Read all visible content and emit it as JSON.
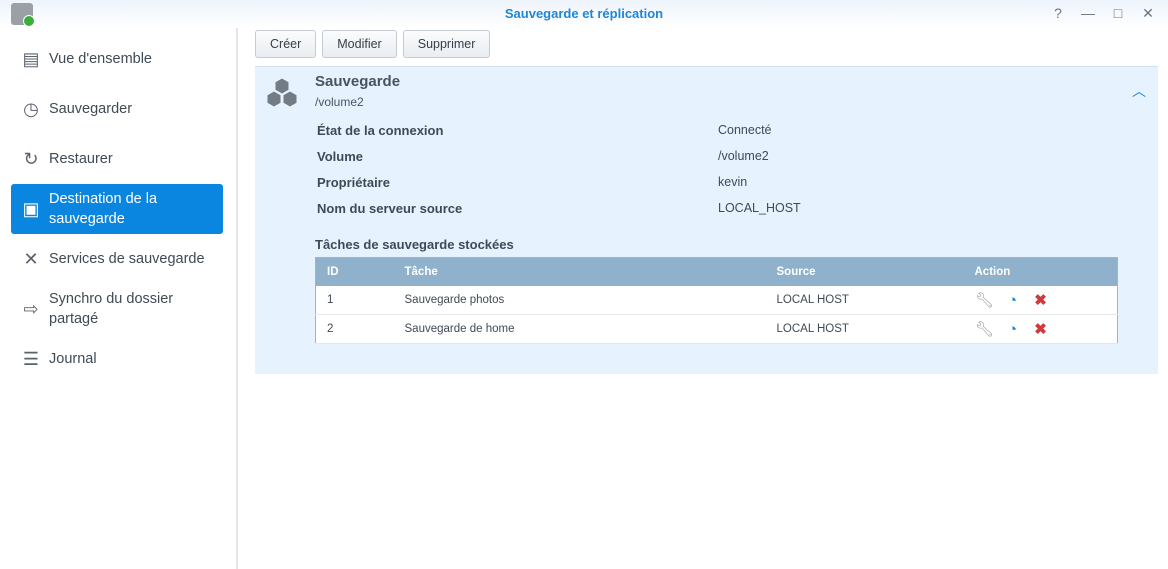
{
  "window": {
    "title": "Sauvegarde et réplication",
    "controls": [
      "?",
      "—",
      "□",
      "✕"
    ]
  },
  "sidebar": {
    "items": [
      {
        "label": "Vue d'ensemble",
        "icon": "overview-icon"
      },
      {
        "label": "Sauvegarder",
        "icon": "backup-history-icon"
      },
      {
        "label": "Restaurer",
        "icon": "restore-icon"
      },
      {
        "label": "Destination de la sauvegarde",
        "icon": "destination-icon",
        "active": true
      },
      {
        "label": "Services de sauvegarde",
        "icon": "tools-icon"
      },
      {
        "label": "Synchro du dossier partagé",
        "icon": "sync-icon"
      },
      {
        "label": "Journal",
        "icon": "log-icon"
      }
    ]
  },
  "toolbar": {
    "create": "Créer",
    "modify": "Modifier",
    "delete": "Supprimer"
  },
  "panel": {
    "title": "Sauvegarde",
    "subtitle": "/volume2",
    "fields": [
      {
        "key": "État de la connexion",
        "value": "Connecté"
      },
      {
        "key": "Volume",
        "value": "/volume2"
      },
      {
        "key": "Propriétaire",
        "value": "kevin"
      },
      {
        "key": "Nom du serveur source",
        "value": "LOCAL_HOST"
      }
    ],
    "tasks_title": "Tâches de sauvegarde stockées",
    "columns": [
      "ID",
      "Tâche",
      "Source",
      "Action"
    ],
    "rows": [
      {
        "id": "1",
        "task": "Sauvegarde photos",
        "source": "LOCAL HOST"
      },
      {
        "id": "2",
        "task": "Sauvegarde de home",
        "source": "LOCAL HOST"
      }
    ]
  }
}
